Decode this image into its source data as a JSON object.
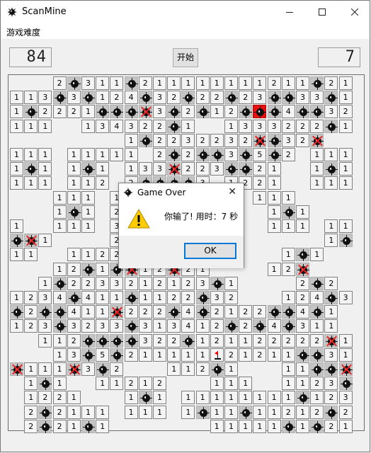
{
  "window": {
    "title": "ScanMine",
    "minimize_icon": "minimize-icon",
    "maximize_icon": "maximize-icon",
    "close_icon": "close-icon"
  },
  "menu": {
    "difficulty": "游戏难度"
  },
  "counters": {
    "mines_left": "84",
    "time": "7"
  },
  "toolbar": {
    "start_label": "开始"
  },
  "dialog": {
    "title": "Game Over",
    "message": "你输了! 用时：7 秒",
    "ok_label": "OK",
    "icon": "warning-icon"
  },
  "board": {
    "legend": {
      "M": "mine",
      "H": "exploded-mine",
      "X": "wrong-flag",
      "F": "flag",
      ".": "empty",
      "digit": "adjacent-count"
    },
    "rows": [
      "...2M311M211111111211M21",
      "113M3M124M32M22M23MM33M1",
      "1M2221MMMX3M2M12MHM4MM32",
      "111..134322M1..1333222M1",
      "........1M2232232XM32X..",
      "111.11111.2M2MM3M5M2.111",
      "1M1.1M1.133X223MM21..1M1",
      "111.112.2MMMM3.1221..111",
      "...111.1M3MM1112.111....",
      "...1M1.2MM3MM3....1M1...",
      "1..111.3M31MM1....111.11",
      "MX1....2M212221.......1M",
      "11..1122M22231.....1M1..11",
      "...12M1MX12X21....12X...",
      "..1M2233212123M1....2M2.",
      "1234M411M1122M32...124M31",
      "M2MM411X222M4M2122MM4M1.",
      "123M3233M313412M2M4M311.",
      "..112MMMM322M121122222X1",
      "...13M5M211111F21211MM31",
      "X111X3M2...112M1...11MMX",
      ".1M1..11212...111..1123M",
      ".1221...1M1.11111111M123M",
      ".2M2111.111.1M11M11212M2",
      ".2M21M1.......11111M1M21"
    ]
  }
}
